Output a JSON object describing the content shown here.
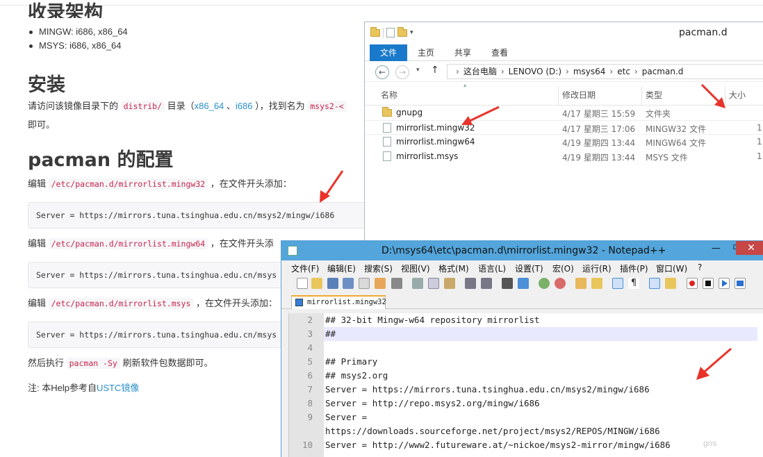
{
  "web": {
    "arch_heading": "收录架构",
    "arch_items": [
      "MINGW: i686, x86_64",
      "MSYS: i686, x86_64"
    ],
    "install_heading": "安装",
    "install_p1_a": "请访问该镜像目录下的 ",
    "install_code1": "distrib/",
    "install_p1_b": " 目录（",
    "install_link1": "x86_64",
    "install_p1_c": " 、",
    "install_link2": "i686",
    "install_p1_d": " ），找到名为 ",
    "install_code2": "msys2-<",
    "install_p2": "即可。",
    "pacman_heading": "pacman 的配置",
    "edit1_prefix": "编辑 ",
    "edit1_code": "/etc/pacman.d/mirrorlist.mingw32",
    "edit1_suffix": " ，在文件开头添加：",
    "code1": "Server = https://mirrors.tuna.tsinghua.edu.cn/msys2/mingw/i686",
    "edit2_prefix": "编辑 ",
    "edit2_code": "/etc/pacman.d/mirrorlist.mingw64",
    "edit2_suffix": " ，在文件开头添",
    "code2": "Server = https://mirrors.tuna.tsinghua.edu.cn/msys",
    "edit3_prefix": "编辑 ",
    "edit3_code": "/etc/pacman.d/mirrorlist.msys",
    "edit3_suffix": " ，在文件开头添加：",
    "code3": "Server = https://mirrors.tuna.tsinghua.edu.cn/msys",
    "then_prefix": "然后执行 ",
    "then_code": "pacman -Sy",
    "then_suffix": " 刷新软件包数据即可。",
    "note_prefix": "注: 本Help参考自",
    "note_link": "USTC镜像"
  },
  "explorer": {
    "title": "pacman.d",
    "ribbon_tabs": [
      "文件",
      "主页",
      "共享",
      "查看"
    ],
    "breadcrumb": [
      "这台电脑",
      "LENOVO (D:)",
      "msys64",
      "etc",
      "pacman.d"
    ],
    "columns": {
      "name": "名称",
      "date": "修改日期",
      "type": "类型",
      "size": "大小"
    },
    "rows": [
      {
        "name": "gnupg",
        "date": "4/17 星期三 15:59",
        "type": "文件夹",
        "size": ""
      },
      {
        "name": "mirrorlist.mingw32",
        "date": "4/17 星期三 17:06",
        "type": "MINGW32 文件",
        "size": "1"
      },
      {
        "name": "mirrorlist.mingw64",
        "date": "4/19 星期四 13:44",
        "type": "MINGW64 文件",
        "size": "1"
      },
      {
        "name": "mirrorlist.msys",
        "date": "4/19 星期四 13:44",
        "type": "MSYS 文件",
        "size": "1"
      }
    ]
  },
  "notepad": {
    "title": "D:\\msys64\\etc\\pacman.d\\mirrorlist.mingw32 - Notepad++",
    "menu": [
      "文件(F)",
      "编辑(E)",
      "搜索(S)",
      "视图(V)",
      "格式(M)",
      "语言(L)",
      "设置(T)",
      "宏(O)",
      "运行(R)",
      "插件(P)",
      "窗口(W)",
      "?"
    ],
    "tab": "mirrorlist.mingw32",
    "lines": [
      {
        "num": "2",
        "text": "## 32-bit Mingw-w64 repository mirrorlist"
      },
      {
        "num": "3",
        "text": "##"
      },
      {
        "num": "4",
        "text": ""
      },
      {
        "num": "5",
        "text": "## Primary"
      },
      {
        "num": "6",
        "text": "## msys2.org"
      },
      {
        "num": "7",
        "text": "Server = https://mirrors.tuna.tsinghua.edu.cn/msys2/mingw/i686"
      },
      {
        "num": "8",
        "text": "Server = http://repo.msys2.org/mingw/i686"
      },
      {
        "num": "9",
        "text": "Server ="
      },
      {
        "num": "",
        "text": "https://downloads.sourceforge.net/project/msys2/REPOS/MINGW/i686"
      },
      {
        "num": "10",
        "text": "Server = http://www2.futureware.at/~nickoe/msys2-mirror/mingw/i686"
      }
    ]
  },
  "watermark": "gos",
  "colors": {
    "accent": "#1979ca",
    "code_red": "#c7254e",
    "link": "#2a8fc9",
    "arrow": "#e8332a",
    "npp_title": "#53a5db"
  }
}
